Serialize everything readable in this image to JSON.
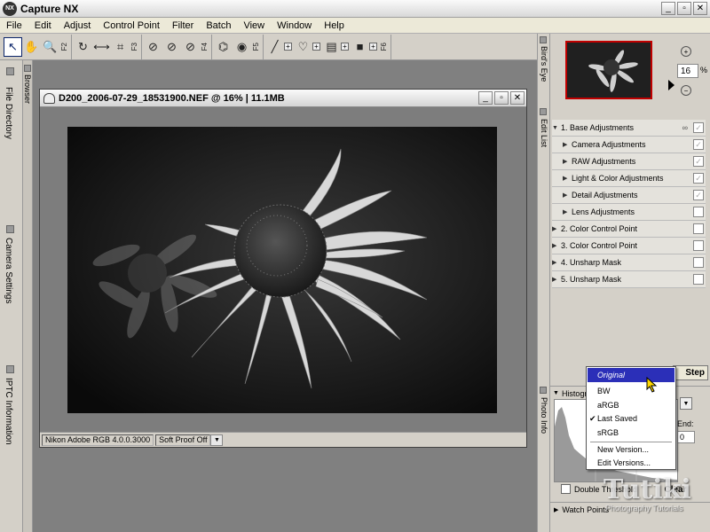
{
  "app": {
    "title": "Capture NX",
    "logo": "NX"
  },
  "window_controls": [
    "_",
    "▫",
    "✕"
  ],
  "menu": [
    "File",
    "Edit",
    "Adjust",
    "Control Point",
    "Filter",
    "Batch",
    "View",
    "Window",
    "Help"
  ],
  "toolbar": {
    "fkeys": [
      "F2",
      "F3",
      "F4",
      "F5",
      "F6"
    ]
  },
  "left_tabs": [
    "File Directory",
    "Camera Settings",
    "IPTC Information"
  ],
  "browser_tab": "Browser",
  "document": {
    "title": "D200_2006-07-29_18531900.NEF  @  16%  |  11.1MB",
    "color_profile": "Nikon Adobe RGB 4.0.0.3000",
    "proof_state": "Soft Proof Off"
  },
  "right_tabs": [
    "Bird's Eye",
    "Edit List",
    "Photo Info"
  ],
  "birds_eye": {
    "zoom": "16",
    "unit": "%"
  },
  "edit_list": {
    "items": [
      {
        "label": "1.  Base Adjustments",
        "level": 0,
        "expanded": true,
        "checked": true
      },
      {
        "label": "Camera Adjustments",
        "level": 1,
        "checked": true
      },
      {
        "label": "RAW Adjustments",
        "level": 1,
        "checked": true
      },
      {
        "label": "Light & Color Adjustments",
        "level": 1,
        "checked": true
      },
      {
        "label": "Detail Adjustments",
        "level": 1,
        "checked": true
      },
      {
        "label": "Lens Adjustments",
        "level": 1,
        "checked": false
      },
      {
        "label": "2.  Color Control Point",
        "level": 0,
        "checked": false
      },
      {
        "label": "3.  Color Control Point",
        "level": 0,
        "checked": false
      },
      {
        "label": "4.  Unsharp Mask",
        "level": 0,
        "checked": false
      },
      {
        "label": "5.  Unsharp Mask",
        "level": 0,
        "checked": false
      }
    ],
    "step_button": "Step"
  },
  "histogram": {
    "title": "Histogram",
    "end_label": "End:",
    "end_value": "0",
    "double_threshold": "Double Threshold",
    "clear_button": "Clear"
  },
  "watch_points": "Watch Points",
  "context_menu": {
    "items": [
      "Original",
      "BW",
      "aRGB",
      "Last Saved",
      "sRGB",
      "New Version...",
      "Edit Versions..."
    ],
    "selected": "Original",
    "checked": "Last Saved"
  },
  "watermark": {
    "main": "Tutiki",
    "sub": "Photography Tutorials"
  }
}
